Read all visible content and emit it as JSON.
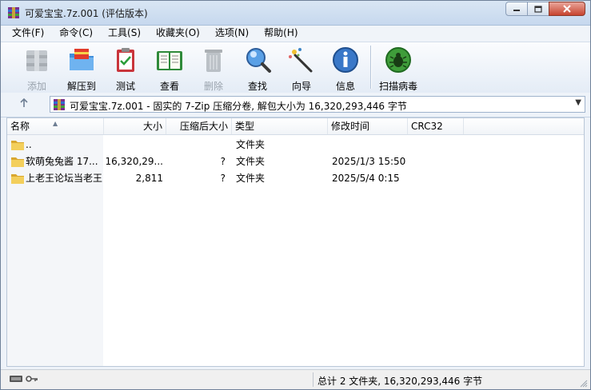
{
  "window": {
    "title": "可爱宝宝.7z.001 (评估版本)",
    "controls": [
      "minimize",
      "maximize",
      "close"
    ]
  },
  "menu": [
    {
      "label": "文件(F)"
    },
    {
      "label": "命令(C)"
    },
    {
      "label": "工具(S)"
    },
    {
      "label": "收藏夹(O)"
    },
    {
      "label": "选项(N)"
    },
    {
      "label": "帮助(H)"
    }
  ],
  "toolbar": [
    {
      "label": "添加",
      "icon": "add-archive-icon",
      "enabled": false
    },
    {
      "label": "解压到",
      "icon": "extract-folder-icon",
      "enabled": true
    },
    {
      "label": "测试",
      "icon": "test-clipboard-icon",
      "enabled": true
    },
    {
      "label": "查看",
      "icon": "view-book-icon",
      "enabled": true
    },
    {
      "label": "删除",
      "icon": "trash-icon",
      "enabled": false
    },
    {
      "label": "查找",
      "icon": "magnifier-icon",
      "enabled": true
    },
    {
      "label": "向导",
      "icon": "wizard-wand-icon",
      "enabled": true
    },
    {
      "label": "信息",
      "icon": "info-icon",
      "enabled": true
    },
    {
      "label": "扫描病毒",
      "icon": "virus-scan-icon",
      "enabled": true
    }
  ],
  "address": {
    "text": "可爱宝宝.7z.001 - 固实的 7-Zip 压缩分卷, 解包大小为 16,320,293,446 字节"
  },
  "columns": [
    {
      "label": "名称"
    },
    {
      "label": "大小"
    },
    {
      "label": "压缩后大小"
    },
    {
      "label": "类型"
    },
    {
      "label": "修改时间"
    },
    {
      "label": "CRC32"
    }
  ],
  "rows": [
    {
      "name": "..",
      "size": "",
      "packed": "",
      "type": "文件夹",
      "modified": "",
      "crc": ""
    },
    {
      "name": "软萌兔兔酱 17...",
      "size": "16,320,29...",
      "packed": "?",
      "type": "文件夹",
      "modified": "2025/1/3 15:50",
      "crc": ""
    },
    {
      "name": "上老王论坛当老王",
      "size": "2,811",
      "packed": "?",
      "type": "文件夹",
      "modified": "2025/5/4 0:15",
      "crc": ""
    }
  ],
  "status": {
    "summary": "总计 2 文件夹, 16,320,293,446 字节"
  }
}
